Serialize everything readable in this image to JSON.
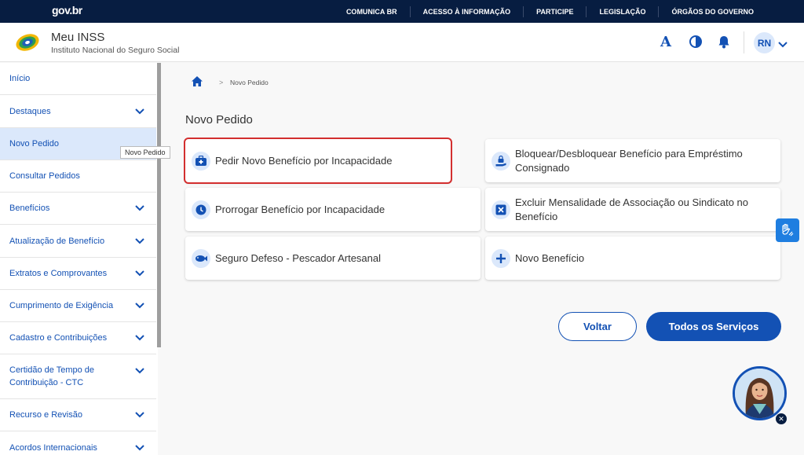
{
  "govbar": {
    "logo": "gov.br",
    "links": [
      "COMUNICA BR",
      "ACESSO À INFORMAÇÃO",
      "PARTICIPE",
      "LEGISLAÇÃO",
      "ÓRGÃOS DO GOVERNO"
    ]
  },
  "header": {
    "title": "Meu INSS",
    "subtitle": "Instituto Nacional do Seguro Social",
    "font_icon_glyph": "A",
    "avatar_initials": "RN"
  },
  "sidebar": {
    "items": [
      {
        "label": "Início",
        "expandable": false
      },
      {
        "label": "Destaques",
        "expandable": true
      },
      {
        "label": "Novo Pedido",
        "expandable": false,
        "active": true
      },
      {
        "label": "Consultar Pedidos",
        "expandable": false
      },
      {
        "label": "Benefícios",
        "expandable": true
      },
      {
        "label": "Atualização de Benefício",
        "expandable": true
      },
      {
        "label": "Extratos e Comprovantes",
        "expandable": true
      },
      {
        "label": "Cumprimento de Exigência",
        "expandable": true
      },
      {
        "label": "Cadastro e Contribuições",
        "expandable": true
      },
      {
        "label": "Certidão de Tempo de Contribuição - CTC",
        "expandable": true
      },
      {
        "label": "Recurso e Revisão",
        "expandable": true
      },
      {
        "label": "Acordos Internacionais",
        "expandable": true
      }
    ],
    "tooltip": "Novo Pedido"
  },
  "breadcrumb": {
    "separator": ">",
    "current": "Novo Pedido"
  },
  "main": {
    "title": "Novo Pedido",
    "cards": [
      {
        "label": "Pedir Novo Benefício por Incapacidade",
        "icon": "medical-briefcase-icon"
      },
      {
        "label": "Bloquear/Desbloquear Benefício para Empréstimo Consignado",
        "icon": "hand-lock-icon"
      },
      {
        "label": "Prorrogar Benefício por Incapacidade",
        "icon": "clock-icon"
      },
      {
        "label": "Excluir Mensalidade de Associação ou Sindicato no Benefício",
        "icon": "remove-x-icon"
      },
      {
        "label": "Seguro Defeso - Pescador Artesanal",
        "icon": "fish-icon"
      },
      {
        "label": "Novo Benefício",
        "icon": "plus-icon"
      }
    ],
    "back_button": "Voltar",
    "all_services_button": "Todos os Serviços"
  },
  "colors": {
    "navy": "#071d41",
    "primary": "#1351b4",
    "highlight_border": "#d32f2f",
    "icon_bg": "#dbe8fb"
  }
}
